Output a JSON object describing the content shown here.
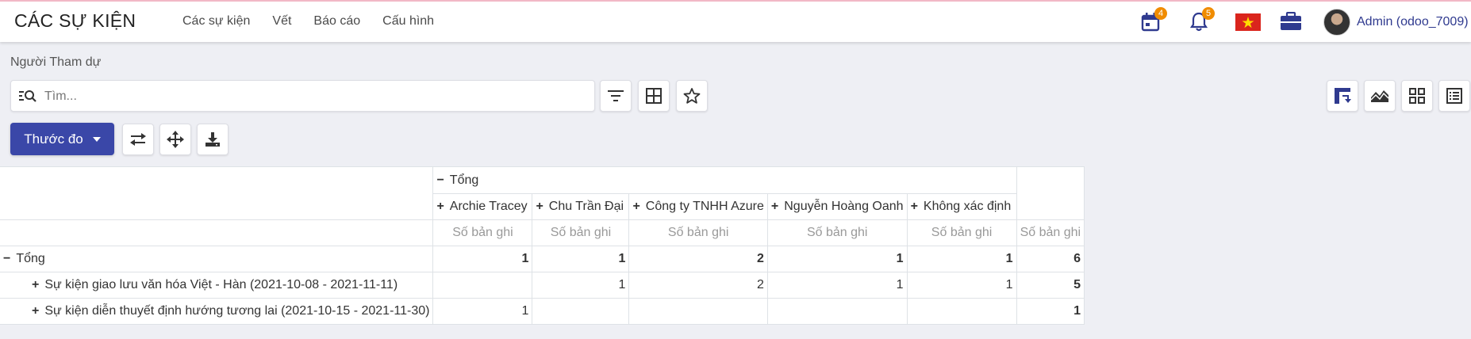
{
  "navbar": {
    "brand": "CÁC SỰ KIỆN",
    "menu": [
      "Các sự kiện",
      "Vết",
      "Báo cáo",
      "Cấu hình"
    ],
    "activity_count": "4",
    "notification_count": "5",
    "user_name": "Admin (odoo_7009)"
  },
  "breadcrumb": "Người Tham dự",
  "search": {
    "placeholder": "Tìm..."
  },
  "measure_button": "Thước đo",
  "pivot": {
    "total_label": "Tổng",
    "measure_label": "Số bản ghi",
    "columns": [
      "Archie Tracey",
      "Chu Trần Đại",
      "Công ty TNHH Azure",
      "Nguyễn Hoàng Oanh",
      "Không xác định"
    ],
    "total_row": {
      "label": "Tổng",
      "values": [
        "1",
        "1",
        "2",
        "1",
        "1"
      ],
      "total": "6"
    },
    "rows": [
      {
        "label": "Sự kiện giao lưu văn hóa Việt - Hàn (2021-10-08 - 2021-11-11)",
        "values": [
          "",
          "1",
          "2",
          "1",
          "1"
        ],
        "total": "5"
      },
      {
        "label": "Sự kiện diễn thuyết định hướng tương lai (2021-10-15 - 2021-11-30)",
        "values": [
          "1",
          "",
          "",
          "",
          ""
        ],
        "total": "1"
      }
    ]
  },
  "colors": {
    "primary": "#3a47a8",
    "badge": "#f08c00",
    "background": "#eeeff4"
  }
}
